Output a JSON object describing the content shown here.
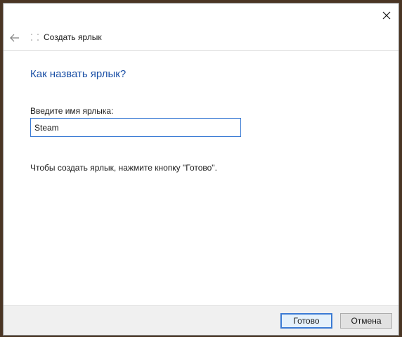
{
  "window": {
    "close_icon": "close-icon"
  },
  "header": {
    "back_icon": "back-arrow-icon",
    "wizard_icon": "shortcut-wizard-icon",
    "title": "Создать ярлык"
  },
  "main": {
    "heading": "Как назвать ярлык?",
    "name_label": "Введите имя ярлыка:",
    "name_value": "Steam",
    "hint": "Чтобы создать ярлык, нажмите кнопку \"Готово\"."
  },
  "footer": {
    "finish_label": "Готово",
    "cancel_label": "Отмена"
  },
  "colors": {
    "accent": "#3b7bd4",
    "heading": "#1a4fa5",
    "footer_bg": "#f0f0f0"
  }
}
